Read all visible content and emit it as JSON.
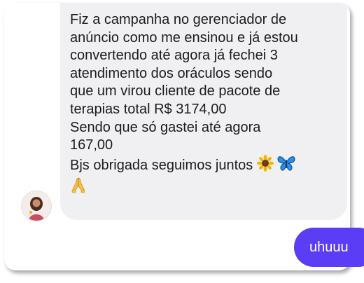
{
  "conversation": {
    "received_message": {
      "lines": [
        "Fiz a campanha no gerenciador de",
        "anúncio como me ensinou e já estou",
        "convertendo até agora já fechei 3",
        "atendimento dos oráculos sendo",
        "que um virou cliente de pacote de",
        "terapias total R$ 3174,00",
        "Sendo que só gastei até agora",
        "167,00",
        "Bjs obrigada seguimos juntos"
      ],
      "trailing_emojis": [
        "sunflower-icon",
        "butterfly-icon",
        "folded-hands-icon"
      ]
    },
    "sent_message": {
      "text": "uhuuu"
    }
  },
  "colors": {
    "received_bubble": "#f0f0f2",
    "sent_bubble": "#5b3df5",
    "text": "#1c1c1e"
  }
}
